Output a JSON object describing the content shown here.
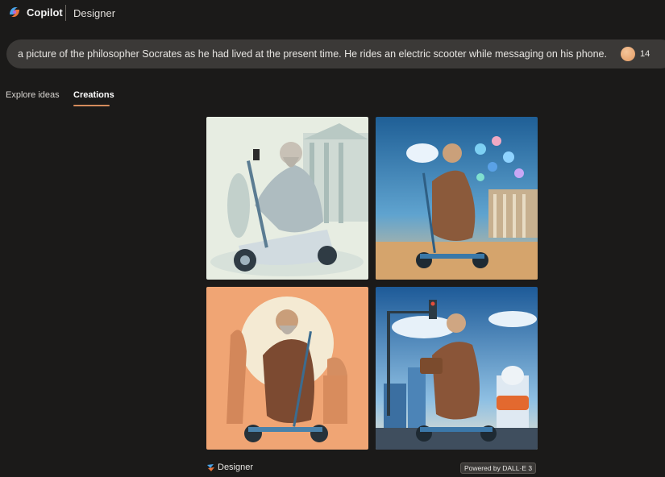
{
  "header": {
    "app_name": "Copilot",
    "product_name": "Designer",
    "logo_icon": "copilot-logo-icon"
  },
  "prompt": {
    "text": "a picture of the philosopher Socrates as he had lived at the present time. He rides an electric scooter while messaging on his phone.",
    "boost_count": "14",
    "boost_icon": "boost-coin-icon"
  },
  "tabs": [
    {
      "label": "Explore ideas",
      "active": false
    },
    {
      "label": "Creations",
      "active": true
    }
  ],
  "images": [
    {
      "name": "image-1",
      "palette": [
        "#e9efe3",
        "#c8d8d2",
        "#7c97a6"
      ]
    },
    {
      "name": "image-2",
      "palette": [
        "#2a6fa3",
        "#f1d9a8",
        "#8a5a3c"
      ]
    },
    {
      "name": "image-3",
      "palette": [
        "#f0a574",
        "#f2e8cf",
        "#7d4a32"
      ]
    },
    {
      "name": "image-4",
      "palette": [
        "#2c6fb0",
        "#e9d6a8",
        "#8f5a3a"
      ]
    }
  ],
  "footer": {
    "brand_label": "Designer",
    "powered_label": "Powered by DALL·E 3"
  }
}
